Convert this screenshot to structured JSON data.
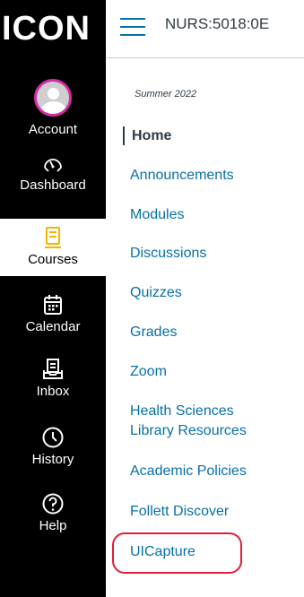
{
  "global_nav": {
    "logo": "ICON",
    "items": [
      {
        "label": "Account",
        "icon": "avatar-icon"
      },
      {
        "label": "Dashboard",
        "icon": "dashboard-icon"
      },
      {
        "label": "Courses",
        "icon": "courses-icon",
        "active": true
      },
      {
        "label": "Calendar",
        "icon": "calendar-icon"
      },
      {
        "label": "Inbox",
        "icon": "inbox-icon"
      },
      {
        "label": "History",
        "icon": "history-icon"
      },
      {
        "label": "Help",
        "icon": "help-icon"
      }
    ]
  },
  "header": {
    "course_title": "NURS:5018:0E"
  },
  "course_nav": {
    "term": "Summer 2022",
    "links": [
      {
        "label": "Home",
        "active": true
      },
      {
        "label": "Announcements"
      },
      {
        "label": "Modules"
      },
      {
        "label": "Discussions"
      },
      {
        "label": "Quizzes"
      },
      {
        "label": "Grades"
      },
      {
        "label": "Zoom"
      },
      {
        "label": "Health Sciences"
      },
      {
        "label": "Library Resources"
      },
      {
        "label": "Academic Policies"
      },
      {
        "label": "Follett Discover"
      },
      {
        "label": "UICapture"
      }
    ]
  },
  "colors": {
    "nav_bg": "#000000",
    "link": "#0770a3",
    "avatar_ring": "#d42ca4",
    "courses_icon": "#f5b400",
    "highlight": "#e01f37"
  }
}
